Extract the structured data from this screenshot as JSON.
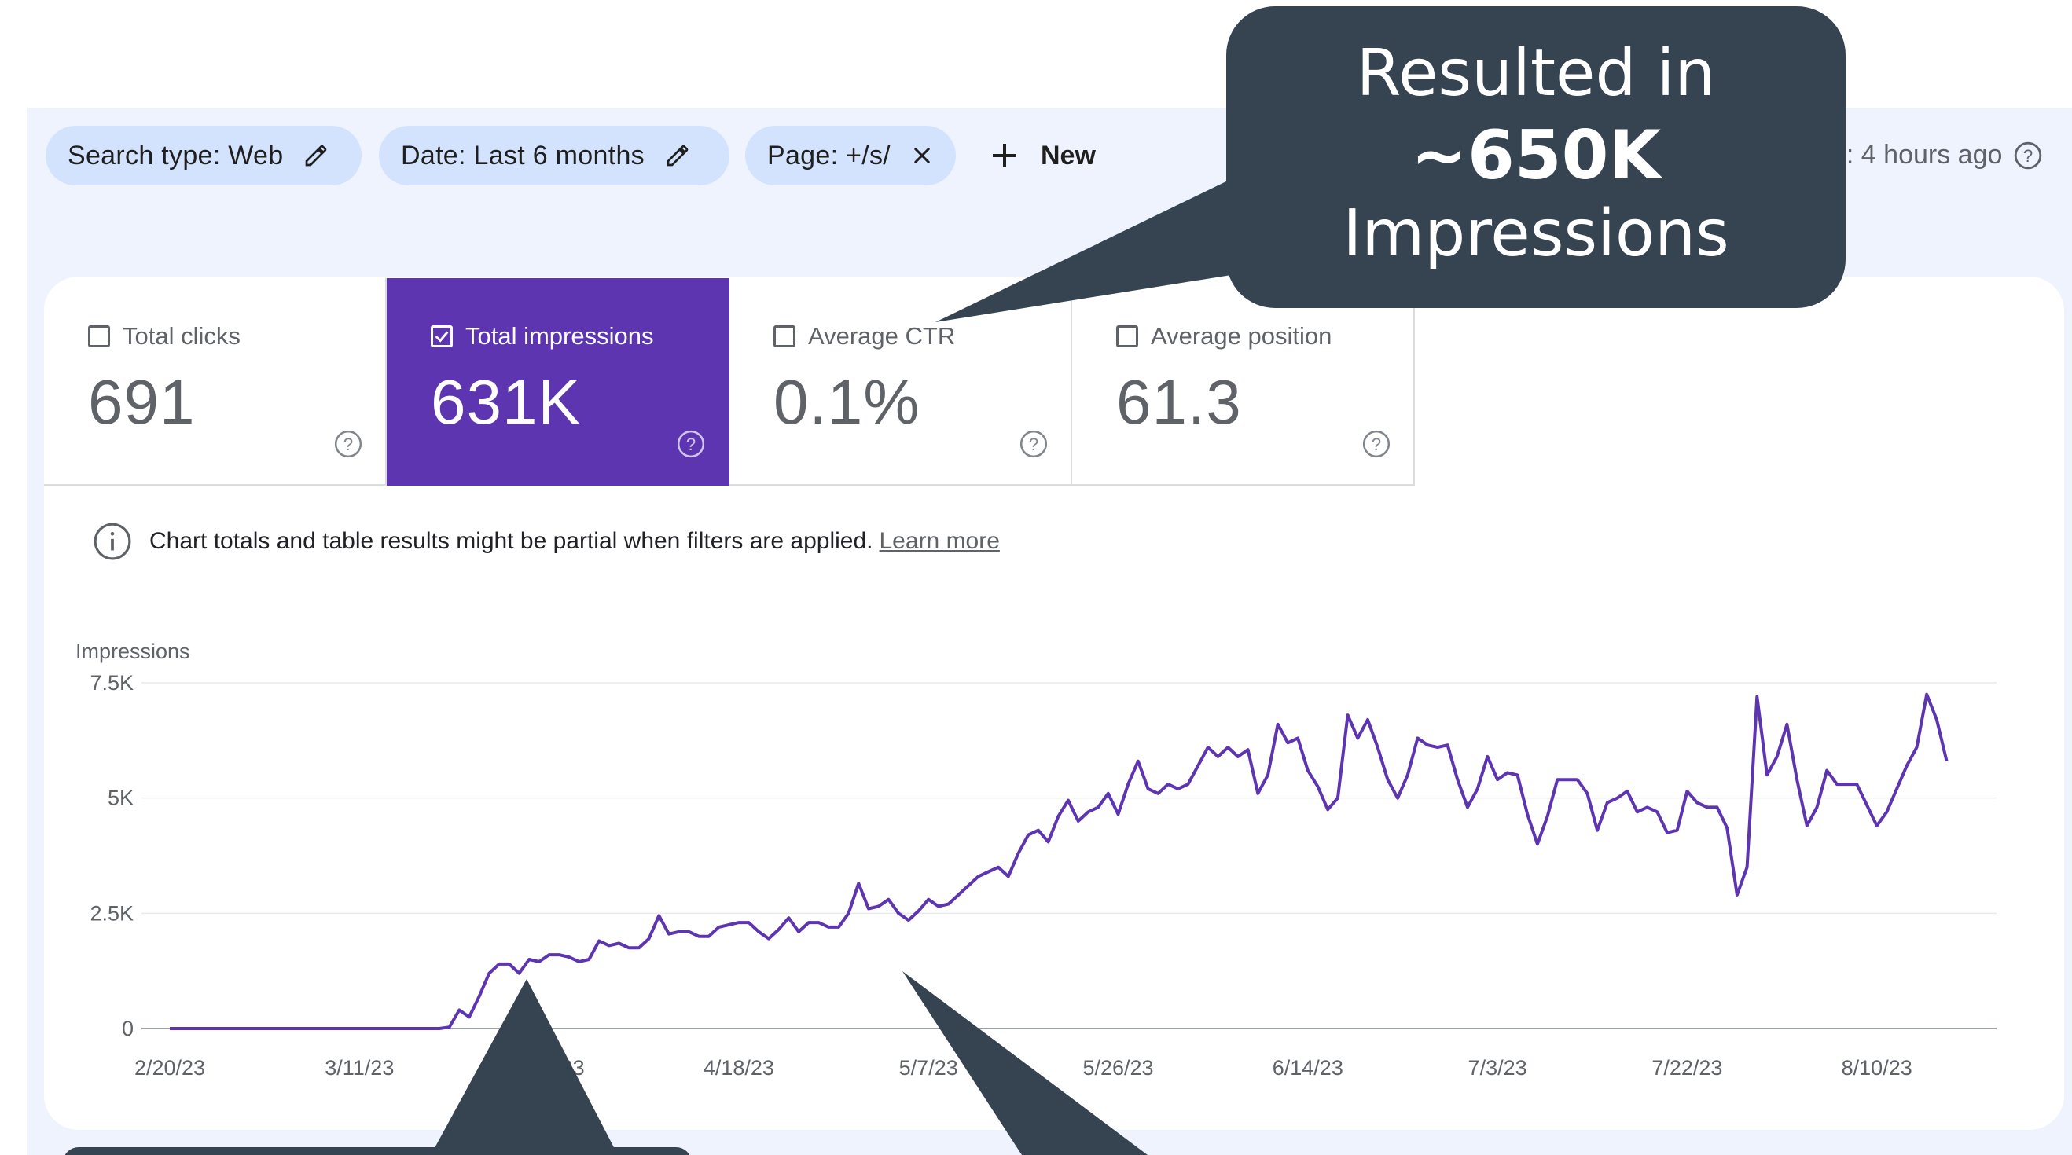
{
  "filters": {
    "search_type": "Search type: Web",
    "date": "Date: Last 6 months",
    "page": "Page: +/s/",
    "new_label": "New"
  },
  "last_updated": "d: 4 hours ago",
  "metrics": [
    {
      "label": "Total clicks",
      "value": "691",
      "selected": false
    },
    {
      "label": "Total impressions",
      "value": "631K",
      "selected": true
    },
    {
      "label": "Average CTR",
      "value": "0.1%",
      "selected": false
    },
    {
      "label": "Average position",
      "value": "61.3",
      "selected": false
    }
  ],
  "notice": {
    "text": "Chart totals and table results might be partial when filters are applied.",
    "link": "Learn more"
  },
  "callout": {
    "line1": "Resulted in",
    "line2": "~650K",
    "line3": "Impressions"
  },
  "colors": {
    "accent": "#5e35b1",
    "chip": "#d3e3fd",
    "callout_bg": "#364350",
    "line": "#5e35b1"
  },
  "chart_data": {
    "type": "line",
    "title": "",
    "ylabel": "Impressions",
    "xlabel": "",
    "ylim": [
      0,
      7500
    ],
    "yticks": [
      {
        "value": 0,
        "label": "0"
      },
      {
        "value": 2500,
        "label": "2.5K"
      },
      {
        "value": 5000,
        "label": "5K"
      },
      {
        "value": 7500,
        "label": "7.5K"
      }
    ],
    "x_start": "2/20/23",
    "xticks": [
      {
        "day": 0,
        "label": "2/20/23"
      },
      {
        "day": 19,
        "label": "3/11/23"
      },
      {
        "day": 38,
        "label": "3/30/23"
      },
      {
        "day": 57,
        "label": "4/18/23"
      },
      {
        "day": 76,
        "label": "5/7/23"
      },
      {
        "day": 95,
        "label": "5/26/23"
      },
      {
        "day": 114,
        "label": "6/14/23"
      },
      {
        "day": 133,
        "label": "7/3/23"
      },
      {
        "day": 152,
        "label": "7/22/23"
      },
      {
        "day": 171,
        "label": "8/10/23"
      }
    ],
    "grid": true,
    "series": [
      {
        "name": "Impressions",
        "values": [
          0,
          0,
          0,
          0,
          0,
          0,
          0,
          0,
          0,
          0,
          0,
          0,
          0,
          0,
          0,
          0,
          0,
          0,
          0,
          0,
          0,
          0,
          0,
          0,
          0,
          0,
          0,
          0,
          30,
          400,
          250,
          700,
          1200,
          1400,
          1400,
          1200,
          1500,
          1450,
          1600,
          1600,
          1550,
          1450,
          1500,
          1900,
          1800,
          1850,
          1750,
          1750,
          1950,
          2450,
          2050,
          2100,
          2100,
          2000,
          2000,
          2200,
          2250,
          2300,
          2300,
          2100,
          1950,
          2150,
          2400,
          2100,
          2300,
          2300,
          2200,
          2200,
          2500,
          3150,
          2600,
          2650,
          2800,
          2500,
          2350,
          2550,
          2800,
          2650,
          2700,
          2900,
          3100,
          3300,
          3400,
          3500,
          3300,
          3800,
          4200,
          4300,
          4050,
          4600,
          4950,
          4500,
          4700,
          4800,
          5100,
          4650,
          5300,
          5800,
          5200,
          5100,
          5300,
          5200,
          5300,
          5700,
          6100,
          5900,
          6100,
          5900,
          6050,
          5100,
          5500,
          6600,
          6200,
          6300,
          5600,
          5250,
          4750,
          5000,
          6800,
          6300,
          6700,
          6100,
          5400,
          5000,
          5500,
          6300,
          6150,
          6100,
          6150,
          5400,
          4800,
          5200,
          5900,
          5400,
          5550,
          5500,
          4650,
          4000,
          4600,
          5400,
          5400,
          5400,
          5100,
          4300,
          4900,
          5000,
          5150,
          4700,
          4800,
          4700,
          4250,
          4300,
          5150,
          4900,
          4800,
          4800,
          4350,
          2900,
          3500,
          7200,
          5500,
          5900,
          6600,
          5400,
          4400,
          4800,
          5600,
          5300,
          5300,
          5300,
          4850,
          4400,
          4700,
          5200,
          5700,
          6100,
          7250,
          6700,
          5800
        ]
      }
    ]
  }
}
